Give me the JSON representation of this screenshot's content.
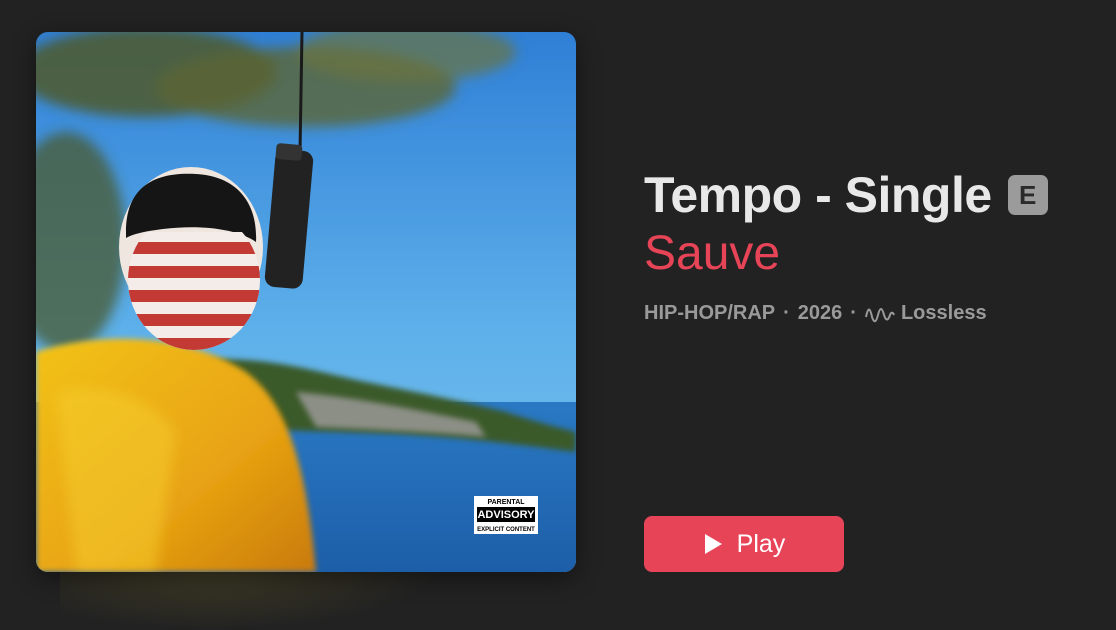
{
  "album": {
    "title": "Tempo - Single",
    "explicit_badge": "E",
    "artist": "Sauve",
    "genre": "HIP-HOP/RAP",
    "year": "2026",
    "quality": "Lossless",
    "separator": "·"
  },
  "artwork": {
    "advisory_line1": "PARENTAL",
    "advisory_line2": "ADVISORY",
    "advisory_line3": "EXPLICIT CONTENT"
  },
  "actions": {
    "play_label": "Play",
    "play_icon": "play-icon",
    "accent_color": "#e84458"
  },
  "colors": {
    "background": "#222222",
    "title": "#e8e8e8",
    "meta": "#9a9a9a"
  }
}
